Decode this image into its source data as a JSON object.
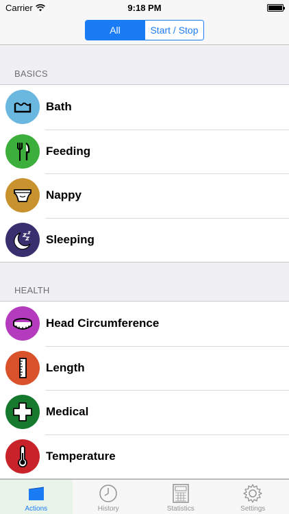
{
  "status_bar": {
    "carrier": "Carrier",
    "time": "9:18 PM"
  },
  "nav": {
    "segments": [
      {
        "label": "All",
        "selected": true
      },
      {
        "label": "Start / Stop",
        "selected": false
      }
    ]
  },
  "sections": [
    {
      "header": "BASICS",
      "items": [
        {
          "label": "Bath",
          "icon": "bath-icon",
          "color": "#6ab7e0"
        },
        {
          "label": "Feeding",
          "icon": "fork-knife-icon",
          "color": "#3cae3c"
        },
        {
          "label": "Nappy",
          "icon": "nappy-icon",
          "color": "#c8922e"
        },
        {
          "label": "Sleeping",
          "icon": "moon-sleep-icon",
          "color": "#3a2f6e"
        }
      ]
    },
    {
      "header": "HEALTH",
      "items": [
        {
          "label": "Head Circumference",
          "icon": "tape-measure-icon",
          "color": "#b43bbd"
        },
        {
          "label": "Length",
          "icon": "ruler-icon",
          "color": "#d9522c"
        },
        {
          "label": "Medical",
          "icon": "medical-cross-icon",
          "color": "#167a2e"
        },
        {
          "label": "Temperature",
          "icon": "thermometer-icon",
          "color": "#c8232a"
        }
      ]
    }
  ],
  "tabs": [
    {
      "label": "Actions",
      "icon": "actions-icon",
      "active": true
    },
    {
      "label": "History",
      "icon": "clock-icon",
      "active": false
    },
    {
      "label": "Statistics",
      "icon": "calculator-icon",
      "active": false
    },
    {
      "label": "Settings",
      "icon": "gear-icon",
      "active": false
    }
  ],
  "colors": {
    "accent": "#1a7cf5"
  }
}
